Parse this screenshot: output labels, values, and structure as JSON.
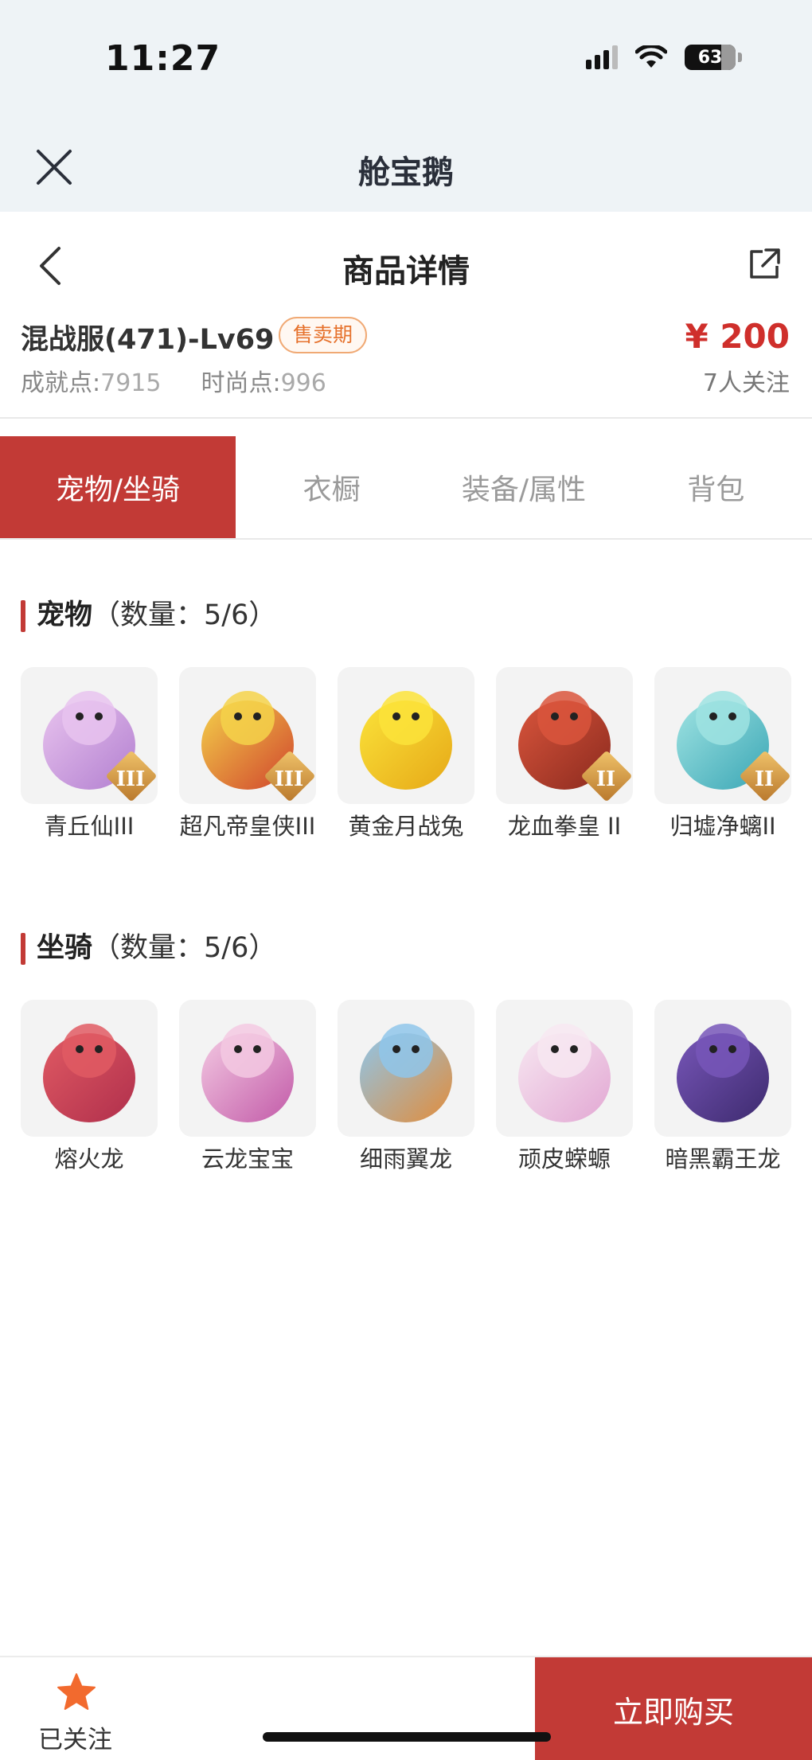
{
  "status_bar": {
    "time": "11:27",
    "battery": "63"
  },
  "app": {
    "title": "舱宝鹅"
  },
  "page": {
    "title": "商品详情"
  },
  "product": {
    "name": "混战服(471)-Lv69",
    "badge": "售卖期",
    "price": "¥ 200",
    "achievement_label": "成就点:",
    "achievement_value": "7915",
    "fashion_label": "时尚点:",
    "fashion_value": "996",
    "followers": "7人关注"
  },
  "tabs": [
    {
      "label": "宠物/坐骑",
      "active": true
    },
    {
      "label": "衣橱",
      "active": false
    },
    {
      "label": "装备/属性",
      "active": false
    },
    {
      "label": "背包",
      "active": false
    }
  ],
  "pets": {
    "label": "宠物",
    "count": "（数量：5/6）",
    "items": [
      {
        "name": "青丘仙III",
        "rank": "III",
        "colors": [
          "#e8c3ee",
          "#b27fd0"
        ]
      },
      {
        "name": "超凡帝皇侠III",
        "rank": "III",
        "colors": [
          "#f4d24a",
          "#d0432d"
        ]
      },
      {
        "name": "黄金月战兔",
        "rank": "",
        "colors": [
          "#fbe33a",
          "#e6a817"
        ]
      },
      {
        "name": "龙血拳皇 II",
        "rank": "II",
        "colors": [
          "#d9553c",
          "#8b2a1e"
        ]
      },
      {
        "name": "归墟净螭II",
        "rank": "II",
        "colors": [
          "#9fe3e2",
          "#3aa6b5"
        ]
      }
    ]
  },
  "mounts": {
    "label": "坐骑",
    "count": "（数量：5/6）",
    "items": [
      {
        "name": "熔火龙",
        "colors": [
          "#e05a63",
          "#b02f4c"
        ]
      },
      {
        "name": "云龙宝宝",
        "colors": [
          "#f3c9e2",
          "#c25aa8"
        ]
      },
      {
        "name": "细雨翼龙",
        "colors": [
          "#8fc6ea",
          "#e28c3a"
        ]
      },
      {
        "name": "顽皮蝾螈",
        "colors": [
          "#f7e7f1",
          "#e2a7d3"
        ]
      },
      {
        "name": "暗黑霸王龙",
        "colors": [
          "#7756b8",
          "#3d2a6e"
        ]
      }
    ]
  },
  "bottom": {
    "follow_label": "已关注",
    "buy_label": "立即购买"
  },
  "colors": {
    "brand_red": "#c23a36",
    "price_red": "#cf2f2b",
    "badge_orange": "#e6722d",
    "follow_star": "#f26a2e"
  },
  "icons": {
    "close": "close-icon",
    "back": "chevron-left-icon",
    "share": "share-icon",
    "follow": "star-icon",
    "signal": "signal-icon",
    "wifi": "wifi-icon",
    "battery": "battery-icon"
  }
}
